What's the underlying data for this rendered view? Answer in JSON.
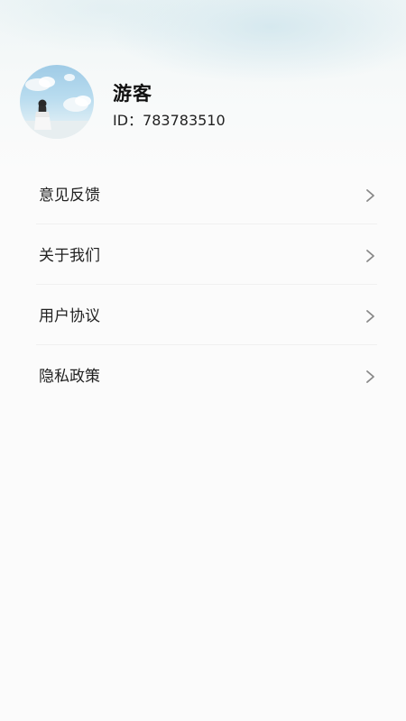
{
  "profile": {
    "name": "游客",
    "id_label": "ID：783783510"
  },
  "menu": {
    "items": [
      {
        "label": "意见反馈",
        "icon": "chevron-right-icon"
      },
      {
        "label": "关于我们",
        "icon": "chevron-right-icon"
      },
      {
        "label": "用户协议",
        "icon": "chevron-right-icon"
      },
      {
        "label": "隐私政策",
        "icon": "chevron-right-icon"
      }
    ]
  },
  "colors": {
    "background": "#fbfbfb",
    "text": "#222222",
    "chevron": "#888888",
    "divider": "#f0f0f0"
  }
}
